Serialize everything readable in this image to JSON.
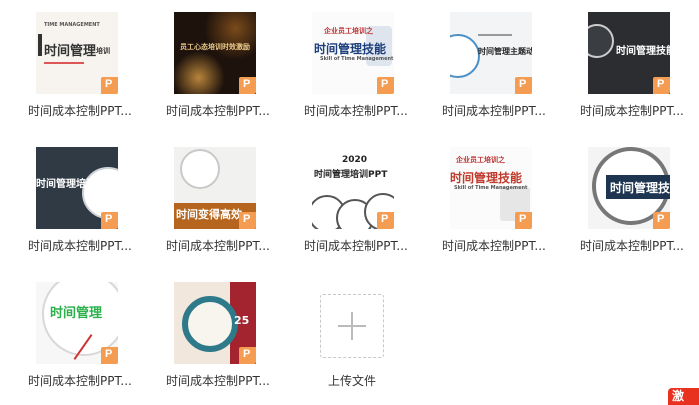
{
  "files": [
    {
      "name": "时间成本控制PPT...",
      "thumb_title": "时间管理",
      "thumb_sub": "TIME MANAGEMENT",
      "thumb_extra": "培训"
    },
    {
      "name": "时间成本控制PPT...",
      "thumb_title": "员工心态培训时效激励",
      "thumb_sub": "",
      "thumb_extra": ""
    },
    {
      "name": "时间成本控制PPT...",
      "thumb_title": "时间管理技能",
      "thumb_sub": "Skill of Time Management",
      "thumb_extra": "企业员工培训之"
    },
    {
      "name": "时间成本控制PPT...",
      "thumb_title": "时间管理主题动态",
      "thumb_sub": "",
      "thumb_extra": ""
    },
    {
      "name": "时间成本控制PPT...",
      "thumb_title": "时间管理技能",
      "thumb_sub": "",
      "thumb_extra": ""
    },
    {
      "name": "时间成本控制PPT...",
      "thumb_title": "时间管理培训",
      "thumb_sub": "",
      "thumb_extra": ""
    },
    {
      "name": "时间成本控制PPT...",
      "thumb_title": "时间变得高效",
      "thumb_sub": "",
      "thumb_extra": ""
    },
    {
      "name": "时间成本控制PPT...",
      "thumb_title": "时间管理培训PPT",
      "thumb_sub": "2020",
      "thumb_extra": ""
    },
    {
      "name": "时间成本控制PPT...",
      "thumb_title": "时间管理技能",
      "thumb_sub": "Skill of Time Management",
      "thumb_extra": "企业员工培训之"
    },
    {
      "name": "时间成本控制PPT...",
      "thumb_title": "时间管理技",
      "thumb_sub": "",
      "thumb_extra": ""
    },
    {
      "name": "时间成本控制PPT...",
      "thumb_title": "时间管理",
      "thumb_sub": "",
      "thumb_extra": ""
    },
    {
      "name": "时间成本控制PPT...",
      "thumb_title": "25",
      "thumb_sub": "",
      "thumb_extra": ""
    }
  ],
  "upload": {
    "label": "上传文件"
  },
  "corner_badge": "激",
  "colors": {
    "ppt_badge": "#f39c52",
    "corner_badge": "#e8321f"
  }
}
